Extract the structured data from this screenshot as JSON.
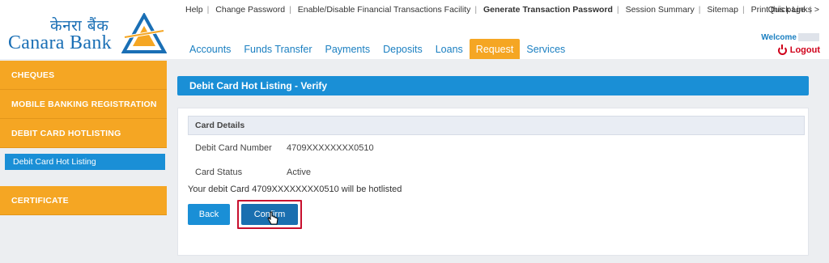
{
  "brand": {
    "hindi_name": "केनरा बैंक",
    "english_name": "Canara Bank",
    "mark_icon": "canara-triangle-logo"
  },
  "top_links": [
    {
      "label": "Help",
      "strong": false
    },
    {
      "label": "Change Password",
      "strong": false
    },
    {
      "label": "Enable/Disable Financial Transactions Facility",
      "strong": false
    },
    {
      "label": "Generate Transaction Password",
      "strong": true
    },
    {
      "label": "Session Summary",
      "strong": false
    },
    {
      "label": "Sitemap",
      "strong": false
    },
    {
      "label": "Print this page",
      "strong": false
    }
  ],
  "quick_links": "Quick Links >",
  "nav_tabs": [
    {
      "label": "Accounts",
      "active": false
    },
    {
      "label": "Funds Transfer",
      "active": false
    },
    {
      "label": "Payments",
      "active": false
    },
    {
      "label": "Deposits",
      "active": false
    },
    {
      "label": "Loans",
      "active": false
    },
    {
      "label": "Request",
      "active": true
    },
    {
      "label": "Services",
      "active": false
    }
  ],
  "welcome": "Welcome",
  "logout": "Logout",
  "sidebar": {
    "items": [
      {
        "label": "CHEQUES"
      },
      {
        "label": "MOBILE BANKING REGISTRATION"
      },
      {
        "label": "DEBIT CARD HOTLISTING"
      },
      {
        "label": "CERTIFICATE"
      }
    ],
    "sub_item": "Debit Card Hot Listing"
  },
  "page": {
    "title": "Debit Card Hot Listing - Verify",
    "section_title": "Card Details",
    "fields": [
      {
        "label": "Debit Card Number",
        "value": "4709XXXXXXXX0510"
      },
      {
        "label": "Card Status",
        "value": "Active"
      }
    ],
    "message": "Your debit Card 4709XXXXXXXX0510 will be hotlisted",
    "back_label": "Back",
    "confirm_label": "Confirm"
  },
  "colors": {
    "accent_orange": "#f5a623",
    "accent_blue": "#1a8fd6",
    "brand_blue": "#1a6fb5",
    "highlight_red": "#c8102e"
  }
}
